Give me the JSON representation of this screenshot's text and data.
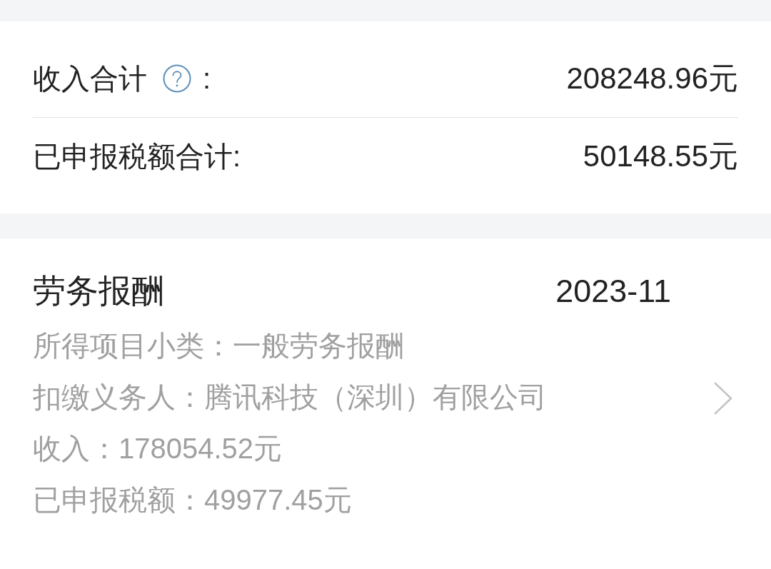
{
  "summary": {
    "rows": [
      {
        "label": "收入合计",
        "help": true,
        "suffix": ":",
        "value": "208248.96元"
      },
      {
        "label": "已申报税额合计:",
        "help": false,
        "value": "50148.55元"
      }
    ]
  },
  "records": [
    {
      "title": "劳务报酬",
      "period": "2023-11",
      "details": [
        "所得项目小类：一般劳务报酬",
        "扣缴义务人：腾讯科技（深圳）有限公司",
        "收入：178054.52元",
        "已申报税额：49977.45元"
      ]
    }
  ]
}
